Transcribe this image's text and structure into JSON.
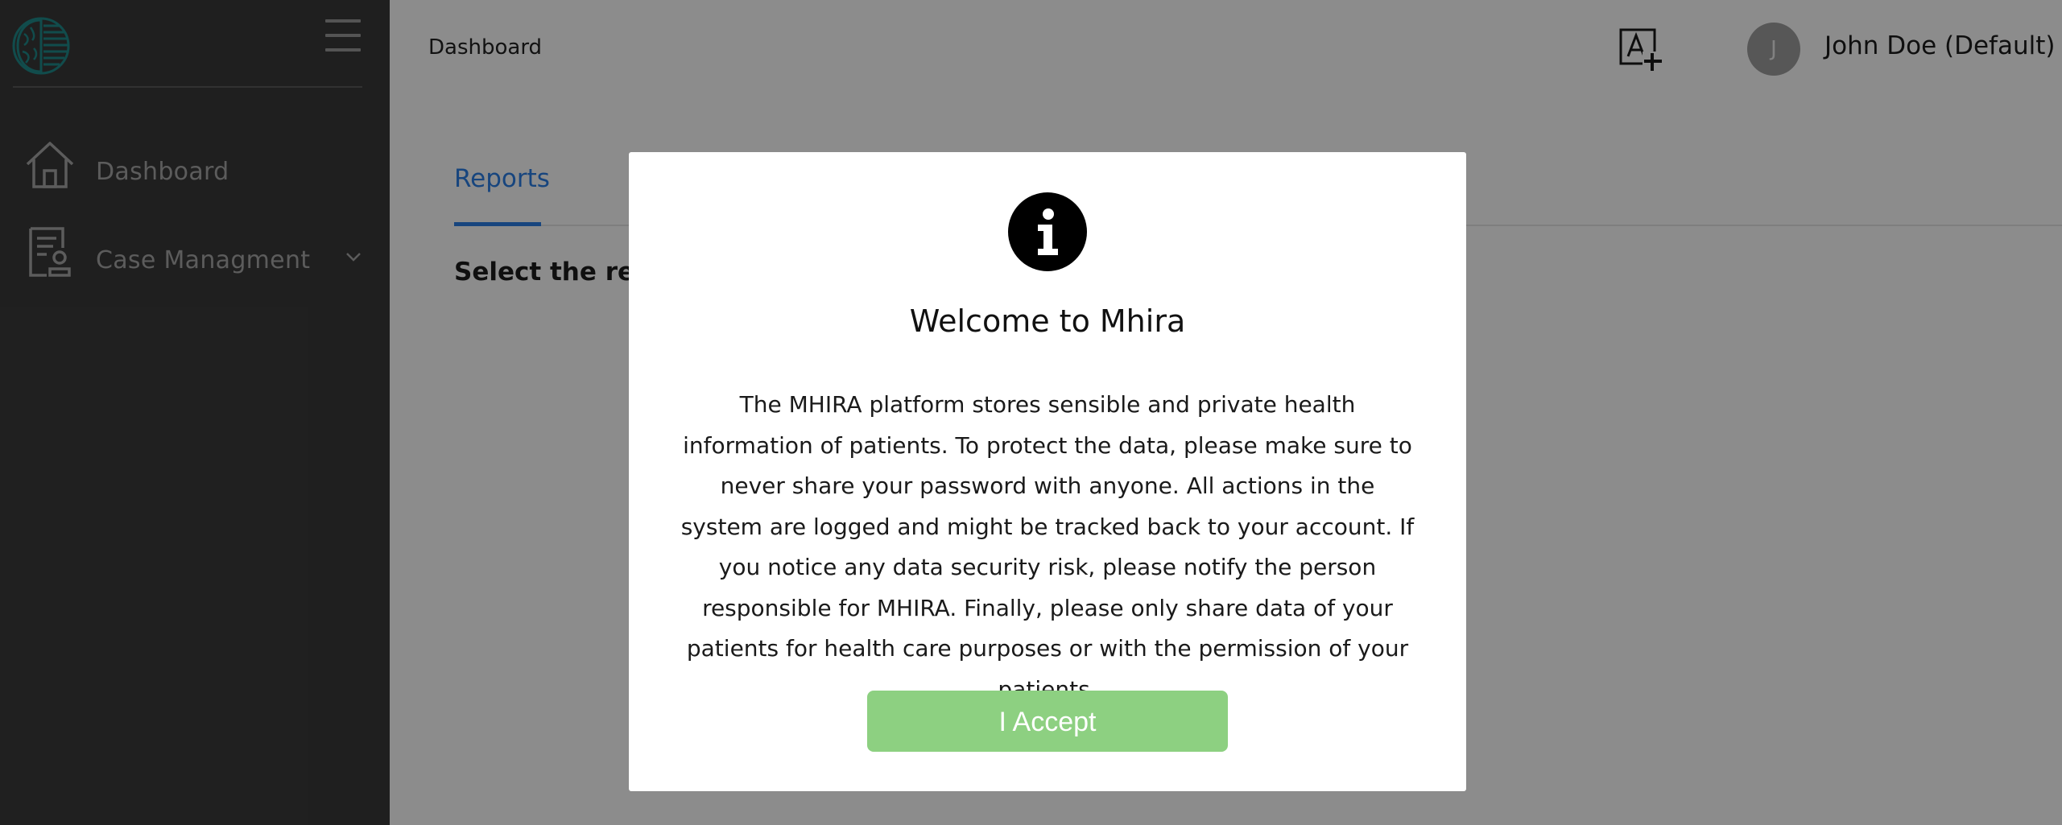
{
  "sidebar": {
    "items": [
      {
        "label": "Dashboard",
        "icon": "home-icon"
      },
      {
        "label": "Case Managment",
        "icon": "case-file-icon",
        "expandable": true
      }
    ]
  },
  "header": {
    "breadcrumb": "Dashboard",
    "user": {
      "avatar_initial": "J",
      "name": "John Doe (Default)"
    }
  },
  "main": {
    "tabs": [
      {
        "label": "Reports",
        "active": true
      }
    ],
    "heading": "Select the repo"
  },
  "modal": {
    "icon": "info-icon",
    "title": "Welcome to Mhira",
    "message": "The MHIRA platform stores sensible and private health information of patients. To protect the data, please make sure to never share your password with anyone. All actions in the system are logged and might be tracked back to your account. If you notice any data security risk, please notify the person responsible for MHIRA. Finally, please only share data of your patients for health care purposes or with the permission of your patients.",
    "accept_label": "I Accept"
  },
  "colors": {
    "sidebar_bg": "#3a3a3a",
    "accent": "#2a7ee6",
    "accept_button": "#8dd081",
    "logo_teal": "#1f8a8a"
  }
}
